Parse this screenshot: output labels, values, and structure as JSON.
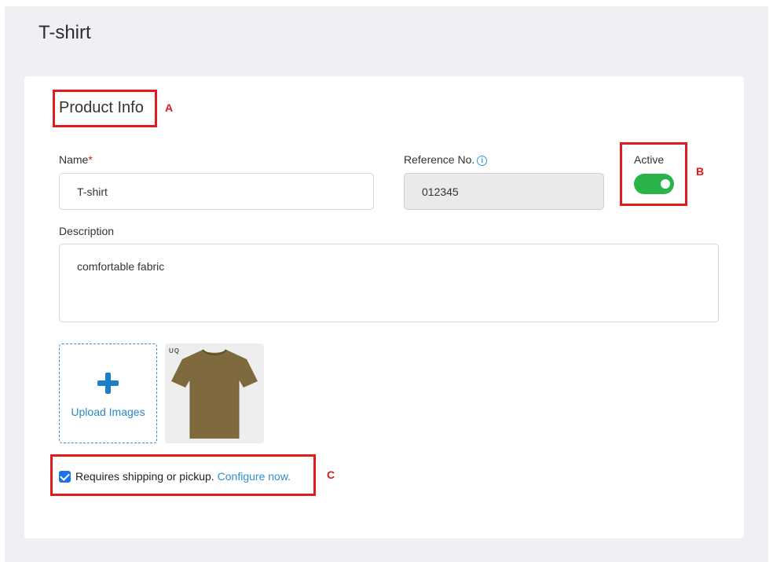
{
  "page": {
    "title": "T-shirt"
  },
  "section": {
    "title": "Product Info"
  },
  "form": {
    "name_label": "Name",
    "name_required_marker": "*",
    "name_value": "T-shirt",
    "reference_label": "Reference No.",
    "reference_value": "012345",
    "active_label": "Active",
    "active_on": true,
    "description_label": "Description",
    "description_value": "comfortable fabric"
  },
  "images": {
    "upload_label": "Upload Images",
    "thumbnail_tag": "UQ",
    "thumbnail_color": "#7e6a3c"
  },
  "shipping": {
    "checked": true,
    "text": "Requires shipping or pickup.",
    "link_text": "Configure now."
  },
  "annotations": {
    "a": "A",
    "b": "B",
    "c": "C"
  },
  "colors": {
    "accent": "#2b8fd0",
    "toggle_on": "#29b34a",
    "annotation": "#e01b1b"
  }
}
